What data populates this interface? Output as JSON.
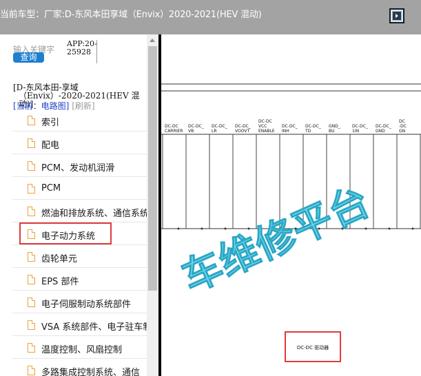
{
  "header": {
    "title": "当前车型：厂家:D-东风本田享域（Envix）2020-2021(HEV 混动)"
  },
  "sidebar": {
    "search_label": "输入关键字",
    "search_button": "查询",
    "app_code_line1": "APP:20-",
    "app_code_line2": "25928",
    "car_line1": "[D-东风本田-享域",
    "car_line2": "（Envix）-2020-2021(HEV 混动)]",
    "current": "[当前：电路图]",
    "refresh": "[刷新]",
    "items": [
      {
        "label": "索引"
      },
      {
        "label": "配电"
      },
      {
        "label": "PCM、发动机润滑"
      },
      {
        "label": "PCM"
      },
      {
        "label": "燃油和排放系统、通信系统"
      },
      {
        "label": "电子动力系统"
      },
      {
        "label": "齿轮单元"
      },
      {
        "label": "EPS 部件"
      },
      {
        "label": "电子伺服制动系统部件"
      },
      {
        "label": "VSA 系统部件、电子驻车制动"
      },
      {
        "label": "温度控制、风扇控制"
      },
      {
        "label": "多路集成控制系统、通信"
      }
    ]
  },
  "diagram": {
    "pins": [
      [
        "DC-DC",
        "CARRIER"
      ],
      [
        "DC-DC_",
        "VB"
      ],
      [
        "DC-DC_",
        "LR"
      ],
      [
        "DC-DC_",
        "VOOVT"
      ],
      [
        "DC-DC",
        "VCC",
        "ENABLE"
      ],
      [
        "DC-DC_",
        "INH"
      ],
      [
        "DC-DC_",
        "TD"
      ],
      [
        "GND_",
        "BU"
      ],
      [
        "DC-DC_",
        "1IN"
      ],
      [
        "DC-DC_",
        "GND"
      ],
      [
        "DC",
        "-DC",
        "GN"
      ]
    ],
    "component_label": "DC-DC 驱动器",
    "watermark": "车维修平台"
  },
  "colors": {
    "topbar": "#a3a3a3",
    "accent": "#1e7fcf",
    "highlight": "#e03a3a",
    "watermark": "#5ad0ea"
  }
}
